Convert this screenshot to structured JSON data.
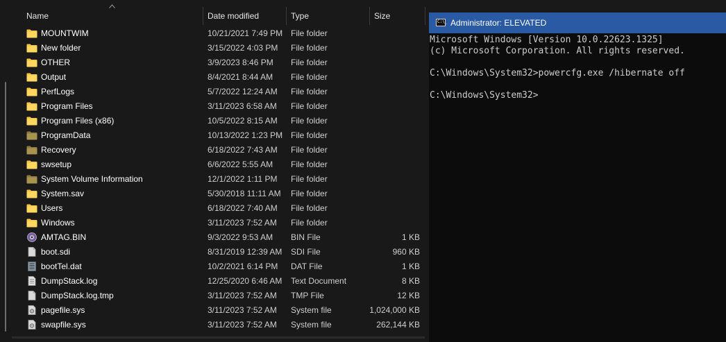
{
  "explorer": {
    "columns": {
      "name": "Name",
      "date": "Date modified",
      "type": "Type",
      "size": "Size"
    },
    "sort": {
      "column": "name",
      "direction": "ascending"
    },
    "files": [
      {
        "name": "MOUNTWIM",
        "date": "10/21/2021 7:49 PM",
        "type": "File folder",
        "size": "",
        "icon": "folder-icon"
      },
      {
        "name": "New folder",
        "date": "3/15/2022 4:03 PM",
        "type": "File folder",
        "size": "",
        "icon": "folder-icon"
      },
      {
        "name": "OTHER",
        "date": "3/9/2023 8:46 PM",
        "type": "File folder",
        "size": "",
        "icon": "folder-icon"
      },
      {
        "name": "Output",
        "date": "8/4/2021 8:44 AM",
        "type": "File folder",
        "size": "",
        "icon": "folder-icon"
      },
      {
        "name": "PerfLogs",
        "date": "5/7/2022 12:24 AM",
        "type": "File folder",
        "size": "",
        "icon": "folder-icon"
      },
      {
        "name": "Program Files",
        "date": "3/11/2023 6:58 AM",
        "type": "File folder",
        "size": "",
        "icon": "folder-icon"
      },
      {
        "name": "Program Files (x86)",
        "date": "10/5/2022 8:15 AM",
        "type": "File folder",
        "size": "",
        "icon": "folder-icon"
      },
      {
        "name": "ProgramData",
        "date": "10/13/2022 1:23 PM",
        "type": "File folder",
        "size": "",
        "icon": "hidden-folder-icon"
      },
      {
        "name": "Recovery",
        "date": "6/18/2022 7:43 AM",
        "type": "File folder",
        "size": "",
        "icon": "hidden-folder-icon"
      },
      {
        "name": "swsetup",
        "date": "6/6/2022 5:55 AM",
        "type": "File folder",
        "size": "",
        "icon": "folder-icon"
      },
      {
        "name": "System Volume Information",
        "date": "12/1/2022 1:11 PM",
        "type": "File folder",
        "size": "",
        "icon": "hidden-folder-icon"
      },
      {
        "name": "System.sav",
        "date": "5/30/2018 11:11 AM",
        "type": "File folder",
        "size": "",
        "icon": "folder-icon"
      },
      {
        "name": "Users",
        "date": "6/18/2022 7:40 AM",
        "type": "File folder",
        "size": "",
        "icon": "folder-icon"
      },
      {
        "name": "Windows",
        "date": "3/11/2023 7:52 AM",
        "type": "File folder",
        "size": "",
        "icon": "folder-icon"
      },
      {
        "name": "AMTAG.BIN",
        "date": "9/3/2022 9:53 AM",
        "type": "BIN File",
        "size": "1 KB",
        "icon": "disc-file-icon"
      },
      {
        "name": "boot.sdi",
        "date": "8/31/2019 12:39 AM",
        "type": "SDI File",
        "size": "960 KB",
        "icon": "file-icon"
      },
      {
        "name": "bootTel.dat",
        "date": "10/2/2021 6:14 PM",
        "type": "DAT File",
        "size": "1 KB",
        "icon": "data-file-icon"
      },
      {
        "name": "DumpStack.log",
        "date": "12/25/2020 6:46 AM",
        "type": "Text Document",
        "size": "8 KB",
        "icon": "text-file-icon"
      },
      {
        "name": "DumpStack.log.tmp",
        "date": "3/11/2023 7:52 AM",
        "type": "TMP File",
        "size": "12 KB",
        "icon": "file-icon"
      },
      {
        "name": "pagefile.sys",
        "date": "3/11/2023 7:52 AM",
        "type": "System file",
        "size": "1,024,000 KB",
        "icon": "system-file-icon"
      },
      {
        "name": "swapfile.sys",
        "date": "3/11/2023 7:52 AM",
        "type": "System file",
        "size": "262,144 KB",
        "icon": "system-file-icon"
      }
    ]
  },
  "terminal": {
    "title": "Administrator: ELEVATED",
    "icon": "cmd-icon",
    "icon_text": "C:\\_",
    "lines": [
      "Microsoft Windows [Version 10.0.22623.1325]",
      "(c) Microsoft Corporation. All rights reserved.",
      "",
      "C:\\Windows\\System32>powercfg.exe /hibernate off",
      "",
      "C:\\Windows\\System32>"
    ]
  },
  "colors": {
    "explorer_bg": "#191919",
    "terminal_bg": "#0c0c0c",
    "titlebar": "#2b5aa5",
    "folder": "#f4c542",
    "hidden_folder": "#9c8a4e"
  }
}
